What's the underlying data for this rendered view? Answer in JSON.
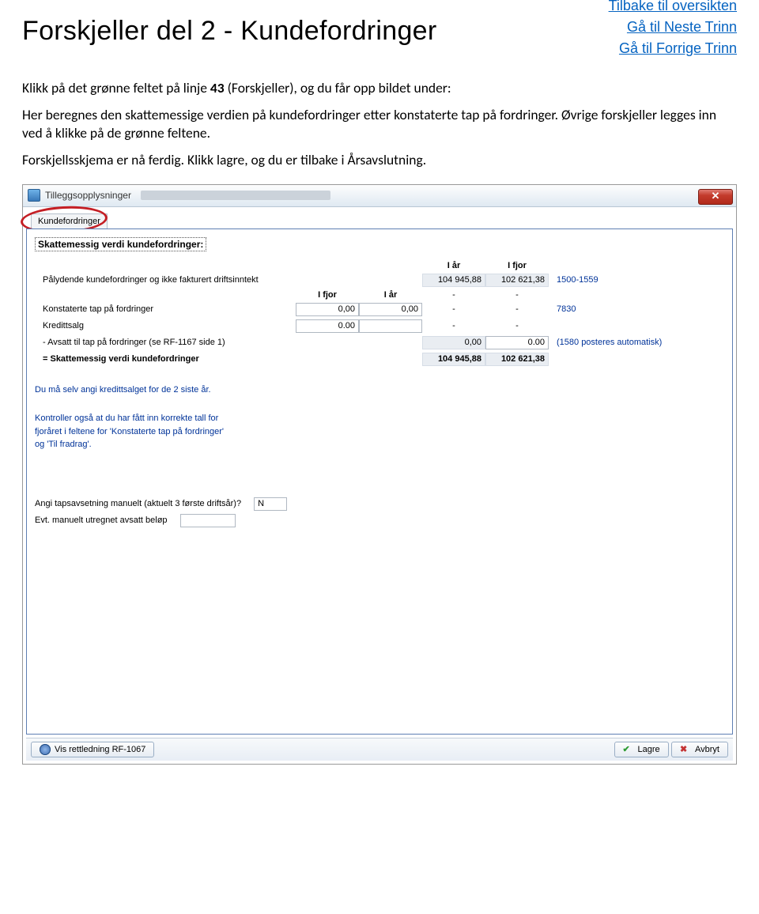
{
  "page": {
    "heading": "Forskjeller del 2 -  Kundefordringer"
  },
  "nav": {
    "overview": "Tilbake til oversikten",
    "next": "Gå til Neste Trinn",
    "prev": "Gå til Forrige Trinn"
  },
  "body_text": {
    "p1_before": "Klikk på det grønne feltet på linje ",
    "p1_bold": "43",
    "p1_after": " (Forskjeller), og du får opp bildet under:",
    "p2": "Her beregnes den skattemessige verdien på kundefordringer etter konstaterte tap på fordringer. Øvrige forskjeller legges inn ved å klikke på de grønne feltene.",
    "p3": "Forskjellsskjema er nå ferdig. Klikk lagre, og du er tilbake i Årsavslutning."
  },
  "win": {
    "title": "Tilleggsopplysninger",
    "tab": "Kundefordringer",
    "close_glyph": "✕",
    "section": "Skattemessig verdi kundefordringer:",
    "col": {
      "i_ar": "I år",
      "i_fjor": "I fjor"
    },
    "rows": {
      "palydende": {
        "label": "Pålydende kundefordringer og ikke fakturert driftsinntekt",
        "iar": "104 945,88",
        "ifjor": "102 621,38",
        "note": "1500-1559"
      },
      "subhdr": {
        "ifjor": "I fjor",
        "iar": "I år"
      },
      "konstaterte": {
        "label": "Konstaterte tap på fordringer",
        "ifjor": "0,00",
        "iar": "0,00",
        "c3": "-",
        "c4": "-",
        "note": "7830"
      },
      "kredittsalg": {
        "label": "Kredittsalg",
        "ifjor": "0.00",
        "iar": "",
        "c3": "-",
        "c4": "-"
      },
      "avsatt": {
        "label": "-  Avsatt til tap på fordringer (se RF-1167 side 1)",
        "iar": "0,00",
        "ifjor": "0.00",
        "note": "(1580 posteres automatisk)"
      },
      "sum": {
        "label": "= Skattemessig verdi kundefordringer",
        "iar": "104 945,88",
        "ifjor": "102 621,38"
      }
    },
    "info1": "Du må selv angi kredittsalget for de 2 siste år.",
    "info2_l1": "Kontroller også at du har fått inn korrekte tall for",
    "info2_l2": "fjoråret i feltene for 'Konstaterte tap på fordringer'",
    "info2_l3": "og 'Til fradrag'.",
    "q1_label": "Angi tapsavsetning manuelt (aktuelt 3 første driftsår)?",
    "q1_value": "N",
    "q2_label": "Evt. manuelt utregnet avsatt beløp",
    "q2_value": "",
    "footer": {
      "hint": "Vis rettledning RF-1067",
      "save": "Lagre",
      "cancel": "Avbryt"
    }
  }
}
